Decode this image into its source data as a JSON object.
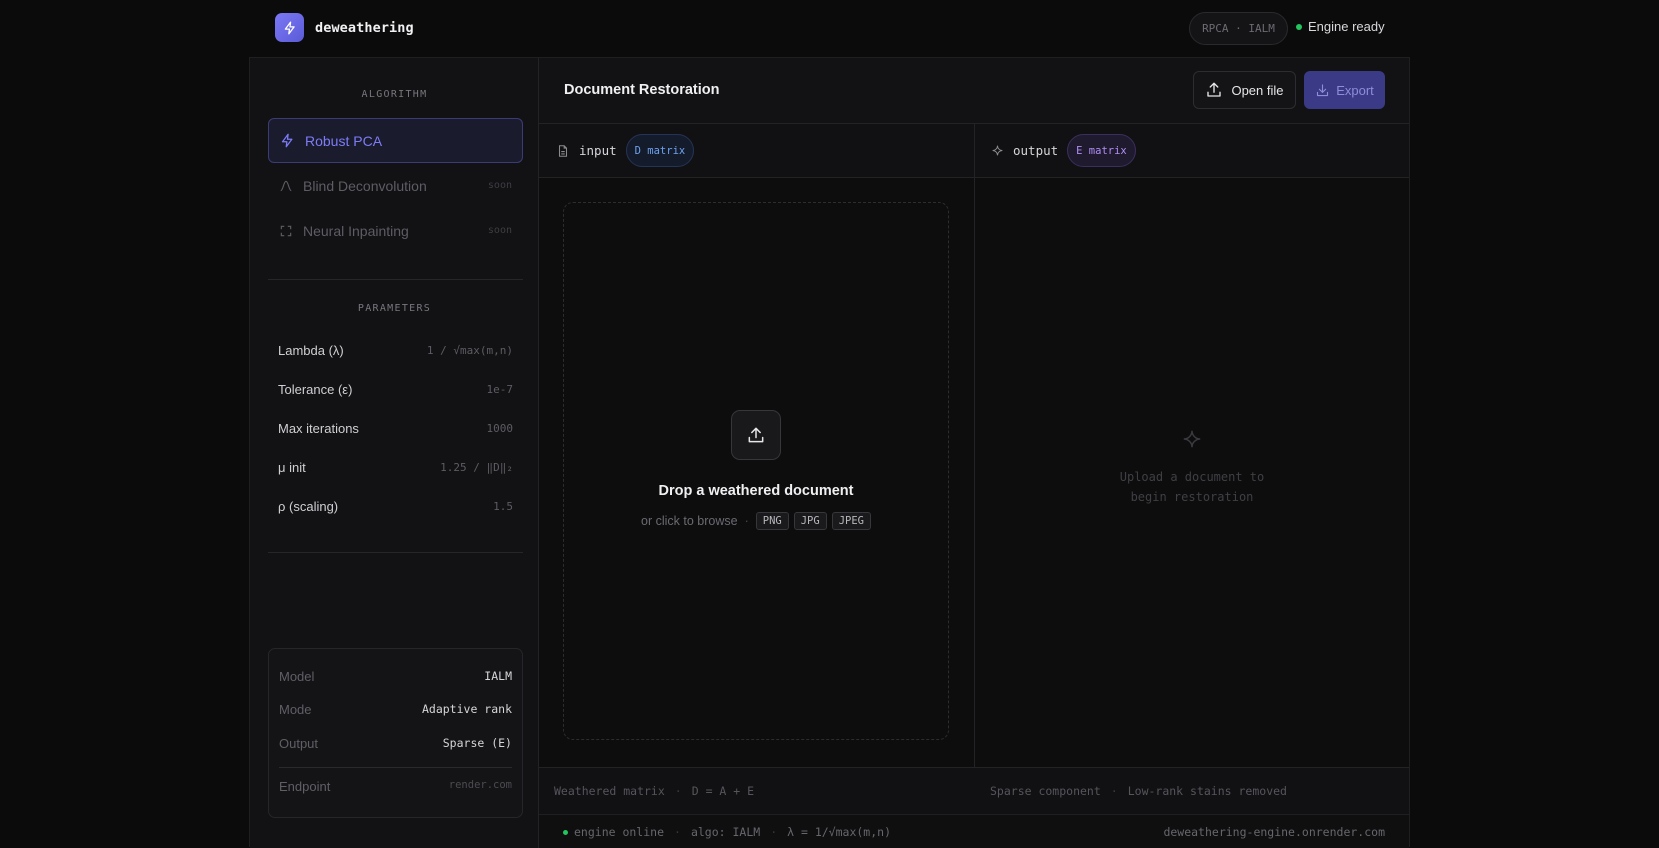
{
  "app": {
    "name": "deweathering",
    "algo_pill": "RPCA · IALM",
    "engine_status": "Engine ready"
  },
  "sidebar": {
    "algorithm_title": "ALGORITHM",
    "algorithms": [
      {
        "label": "Robust PCA",
        "badge": "",
        "icon": "bolt-icon",
        "active": true
      },
      {
        "label": "Blind Deconvolution",
        "badge": "soon",
        "icon": "curve-icon",
        "active": false
      },
      {
        "label": "Neural Inpainting",
        "badge": "soon",
        "icon": "expand-icon",
        "active": false
      }
    ],
    "parameters_title": "PARAMETERS",
    "parameters": [
      {
        "label": "Lambda (λ)",
        "value": "1 / √max(m,n)"
      },
      {
        "label": "Tolerance (ε)",
        "value": "1e-7"
      },
      {
        "label": "Max iterations",
        "value": "1000"
      },
      {
        "label": "μ init",
        "value": "1.25 / ‖D‖₂"
      },
      {
        "label": "ρ (scaling)",
        "value": "1.5"
      }
    ],
    "info": {
      "model_label": "Model",
      "model_value": "IALM",
      "mode_label": "Mode",
      "mode_value": "Adaptive rank",
      "output_label": "Output",
      "output_value": "Sparse (E)",
      "endpoint_label": "Endpoint",
      "endpoint_value": "render.com"
    }
  },
  "main": {
    "title": "Document Restoration",
    "open_file_label": "Open file",
    "export_label": "Export",
    "input_pane": {
      "label": "input",
      "tag": "D matrix"
    },
    "output_pane": {
      "label": "output",
      "tag": "E matrix"
    },
    "dropzone": {
      "title": "Drop a weathered document",
      "subtitle": "or click to browse",
      "separator": "·",
      "formats": [
        "PNG",
        "JPG",
        "JPEG"
      ]
    },
    "output_empty": {
      "line1": "Upload a document to",
      "line2": "begin restoration"
    },
    "footer_left": {
      "text": "Weathered matrix",
      "sep": "·",
      "formula": "D = A + E"
    },
    "footer_right": {
      "text": "Sparse component",
      "sep": "·",
      "detail": "Low-rank stains removed"
    }
  },
  "status_bar": {
    "engine": "engine online",
    "algo": "algo: IALM",
    "lambda": "λ = 1/√max(m,n)",
    "sep": "·",
    "host": "deweathering-engine.onrender.com"
  },
  "colors": {
    "accent": "#6c6cf0",
    "success": "#22c55e",
    "input_tag": "#6ea2ee",
    "output_tag": "#b08ef5"
  }
}
